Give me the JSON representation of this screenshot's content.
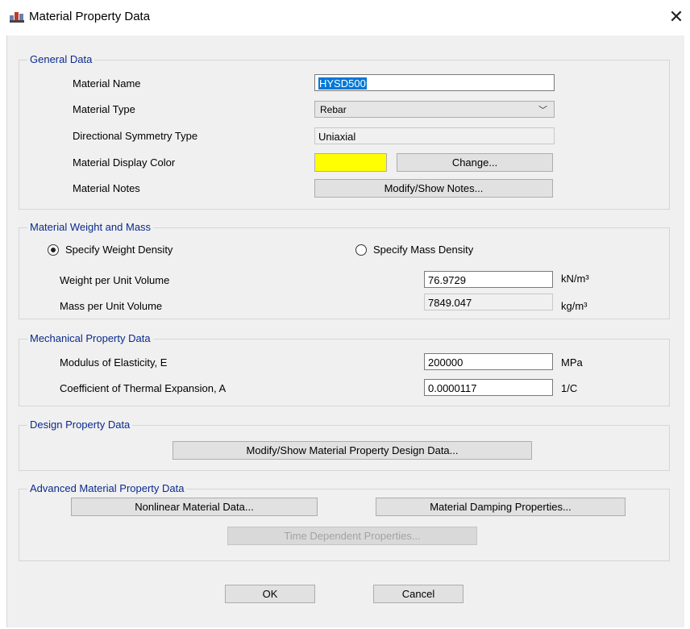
{
  "window": {
    "title": "Material Property Data"
  },
  "general": {
    "legend": "General Data",
    "material_name_label": "Material Name",
    "material_name_value": "HYSD500",
    "material_type_label": "Material Type",
    "material_type_value": "Rebar",
    "symmetry_label": "Directional Symmetry Type",
    "symmetry_value": "Uniaxial",
    "display_color_label": "Material Display Color",
    "display_color": "#ffff00",
    "change_button": "Change...",
    "notes_label": "Material Notes",
    "notes_button": "Modify/Show Notes..."
  },
  "weight": {
    "legend": "Material Weight and Mass",
    "weight_density_option": "Specify Weight Density",
    "mass_density_option": "Specify Mass Density",
    "selected_option": "weight",
    "weight_label": "Weight per Unit Volume",
    "weight_value": "76.9729",
    "weight_unit": "kN/m³",
    "mass_label": "Mass per Unit Volume",
    "mass_value": "7849.047",
    "mass_unit": "kg/m³"
  },
  "mechanical": {
    "legend": "Mechanical Property Data",
    "modulus_label": "Modulus of Elasticity,  E",
    "modulus_value": "200000",
    "modulus_unit": "MPa",
    "thermal_label": "Coefficient of Thermal Expansion,  A",
    "thermal_value": "0.0000117",
    "thermal_unit": "1/C"
  },
  "design": {
    "legend": "Design Property Data",
    "button": "Modify/Show Material Property Design Data..."
  },
  "advanced": {
    "legend": "Advanced Material Property Data",
    "nonlinear_button": "Nonlinear Material Data...",
    "damping_button": "Material Damping Properties...",
    "time_dependent_button": "Time Dependent Properties..."
  },
  "footer": {
    "ok": "OK",
    "cancel": "Cancel"
  },
  "colors": {
    "legend_text": "#0a2a8c",
    "selection": "#0078d7",
    "dialog_bg": "#f0f0f0"
  }
}
